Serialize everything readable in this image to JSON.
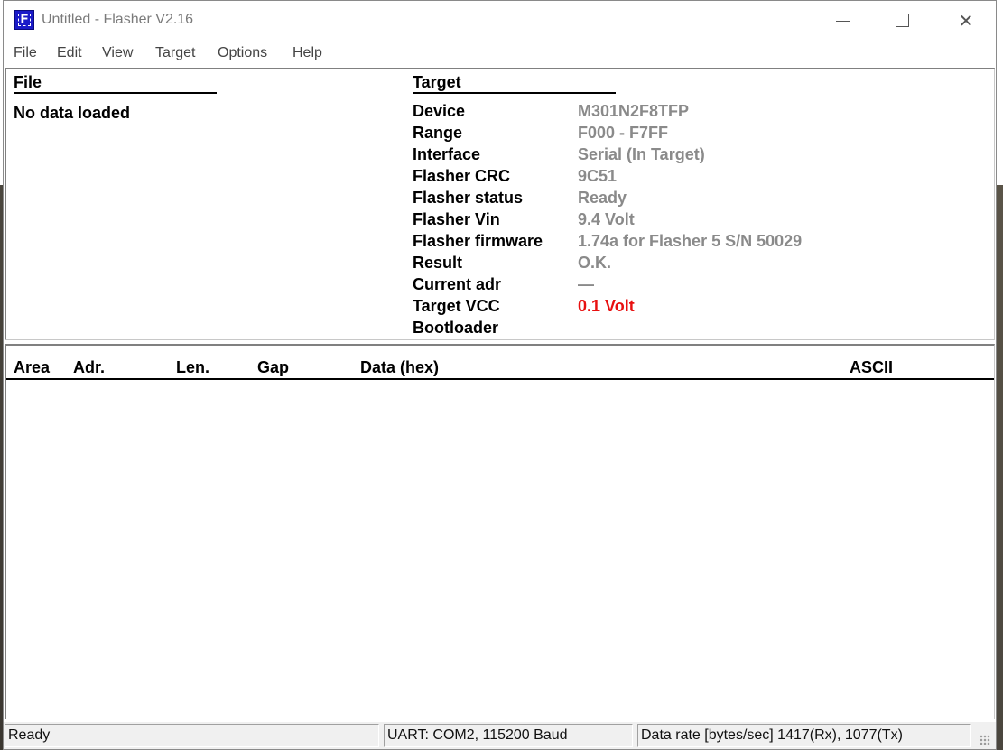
{
  "window": {
    "title": "Untitled - Flasher V2.16",
    "app_icon_glyph": "F",
    "controls": {
      "minimize": "minimize-icon",
      "maximize": "maximize-icon",
      "close": "close-icon"
    }
  },
  "menu": {
    "items": [
      "File",
      "Edit",
      "View",
      "Target",
      "Options",
      "Help"
    ]
  },
  "file_section": {
    "heading": "File",
    "status": "No data loaded"
  },
  "target_section": {
    "heading": "Target",
    "rows": [
      {
        "label": "Device",
        "value": "M301N2F8TFP"
      },
      {
        "label": "Range",
        "value": "F000 - F7FF"
      },
      {
        "label": "Interface",
        "value": "Serial (In Target)"
      },
      {
        "label": "Flasher CRC",
        "value": "9C51"
      },
      {
        "label": "Flasher status",
        "value": "Ready"
      },
      {
        "label": "Flasher Vin",
        "value": "9.4 Volt"
      },
      {
        "label": "Flasher firmware",
        "value": "1.74a for Flasher 5 S/N 50029"
      },
      {
        "label": "Result",
        "value": "O.K."
      },
      {
        "label": "Current adr",
        "value": "—"
      },
      {
        "label": "Target VCC",
        "value": "0.1 Volt",
        "color": "#e81010"
      },
      {
        "label": "Bootloader",
        "value": ""
      }
    ]
  },
  "data_table": {
    "columns": [
      "Area",
      "Adr.",
      "Len.",
      "Gap",
      "Data (hex)",
      "ASCII"
    ],
    "rows": []
  },
  "statusbar": {
    "status": "Ready",
    "connection": "UART: COM2, 115200 Baud",
    "data_rate": "Data rate [bytes/sec] 1417(Rx), 1077(Tx)"
  }
}
